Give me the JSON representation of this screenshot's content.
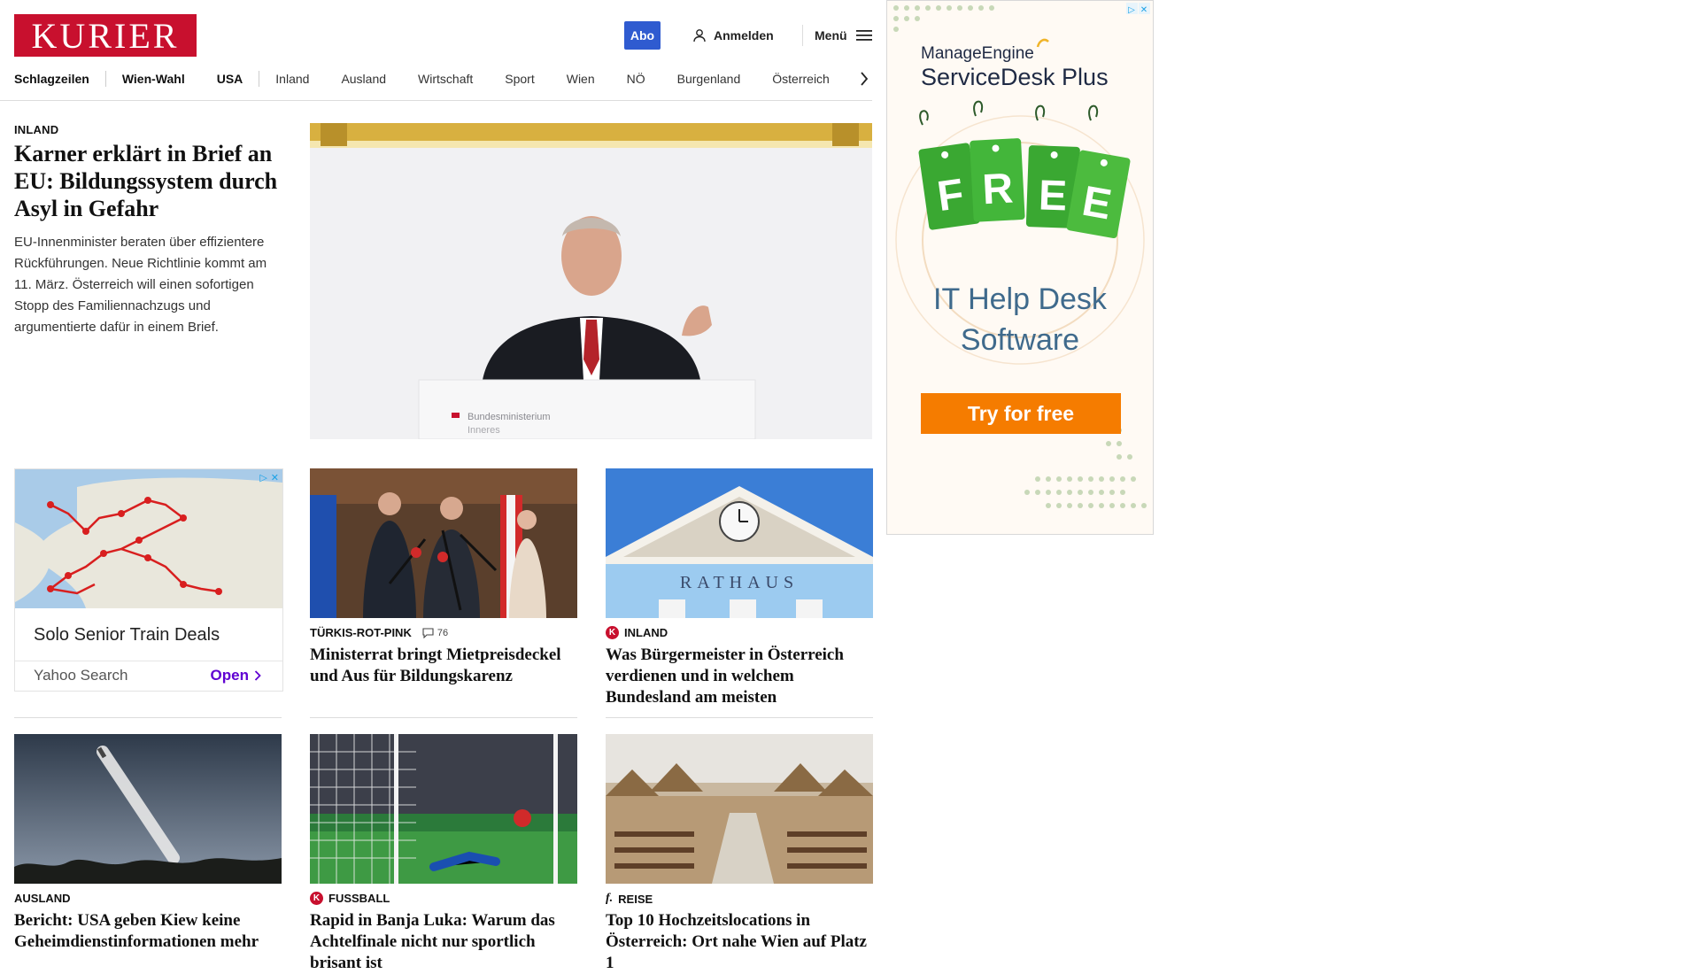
{
  "header": {
    "logo": "KURIER",
    "abo_label": "Abo",
    "login_label": "Anmelden",
    "menu_label": "Menü"
  },
  "nav": {
    "items": [
      "Schlagzeilen",
      "Wien-Wahl",
      "USA",
      "Inland",
      "Ausland",
      "Wirtschaft",
      "Sport",
      "Wien",
      "NÖ",
      "Burgenland",
      "Österreich"
    ]
  },
  "hero": {
    "category": "INLAND",
    "title": "Karner erklärt in Brief an EU: Bildungssystem durch Asyl in Gefahr",
    "teaser": "EU-Innenminister beraten über effizientere Rückführungen. Neue Richtlinie kommt am 11. März. Österreich will einen sofortigen Stopp des Familiennachzugs und argumentierte dafür in einem Brief.",
    "podium_text": "Bundesministerium",
    "podium_text2": "Inneres"
  },
  "ad_small": {
    "title": "Solo Senior Train Deals",
    "source": "Yahoo Search",
    "cta": "Open"
  },
  "cards": [
    {
      "category": "TÜRKIS-ROT-PINK",
      "comments": "76",
      "title": "Ministerrat bringt Mietpreisdeckel und Aus für Bildungskarenz"
    },
    {
      "category": "INLAND",
      "badge": "K",
      "title": "Was Bürgermeister in Österreich verdienen und in welchem Bundesland am meisten",
      "image_text": "RATHAUS"
    },
    {
      "category": "AUSLAND",
      "title": "Bericht: USA geben Kiew keine Geheimdienstinformationen mehr"
    },
    {
      "category": "FUSSBALL",
      "badge": "K",
      "title": "Rapid in Banja Luka: Warum das Achtelfinale nicht nur sportlich brisant ist"
    },
    {
      "category": "REISE",
      "badge": "f.",
      "title": "Top 10 Hochzeitslocations in Österreich: Ort nahe Wien auf Platz 1"
    }
  ],
  "big_ad": {
    "brand": "ManageEngine",
    "product": "ServiceDesk Plus",
    "tag_letters": [
      "F",
      "R",
      "E",
      "E"
    ],
    "headline_1": "IT Help Desk",
    "headline_2": "Software",
    "cta": "Try for free"
  },
  "colors": {
    "brand_red": "#c8102e",
    "abo_blue": "#2f5bd0",
    "ad_orange": "#f57c00",
    "ad_green": "#3aa832"
  }
}
